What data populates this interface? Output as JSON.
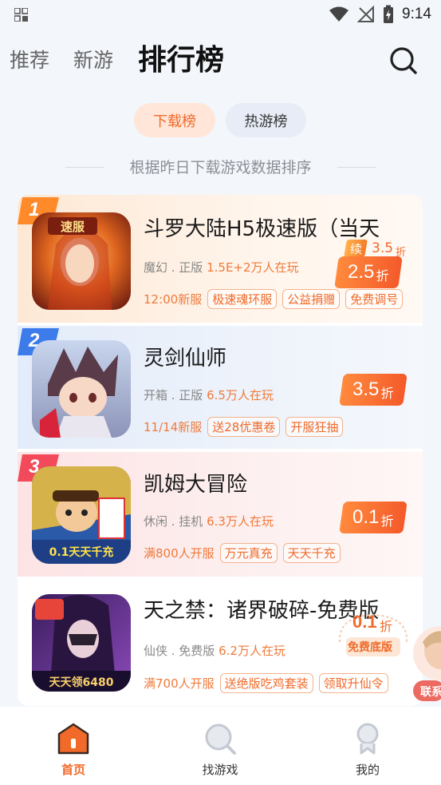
{
  "status_bar": {
    "time": "9:14"
  },
  "nav_tabs": [
    {
      "label": "推荐"
    },
    {
      "label": "新游"
    },
    {
      "label": "排行榜"
    }
  ],
  "sub_tabs": [
    {
      "label": "下载榜"
    },
    {
      "label": "热游榜"
    }
  ],
  "caption": "根据昨日下载游戏数据排序",
  "games": [
    {
      "rank": "1",
      "title": "斗罗大陆H5极速版（当天",
      "category": "魔幻 . 正版",
      "players": "1.5E+2万人在玩",
      "open_label": "12:00新服",
      "tags": [
        "极速魂环服",
        "公益捐赠",
        "免费调号"
      ],
      "renew_label": "续",
      "renew_value": "3.5",
      "renew_unit": "折",
      "discount": "2.5",
      "discount_unit": "折",
      "icon_label": "速服"
    },
    {
      "rank": "2",
      "title": "灵剑仙师",
      "category": "开箱 . 正版",
      "players": "6.5万人在玩",
      "open_label": "11/14新服",
      "tags": [
        "送28优惠卷",
        "开服狂抽"
      ],
      "discount": "3.5",
      "discount_unit": "折"
    },
    {
      "rank": "3",
      "title": "凯姆大冒险",
      "category": "休闲 . 挂机",
      "players": "6.3万人在玩",
      "open_label": "满800人开服",
      "tags": [
        "万元真充",
        "天天千充"
      ],
      "discount": "0.1",
      "discount_unit": "折",
      "icon_label": "0.1天天千充"
    },
    {
      "rank": "",
      "title": "天之禁：诸界破碎-免费版",
      "category": "仙侠 . 免费版",
      "players": "6.2万人在玩",
      "open_label": "满700人开服",
      "tags": [
        "送绝版吃鸡套装",
        "领取升仙令"
      ],
      "discount": "0.1",
      "discount_unit": "折",
      "discount_sub": "免费底版",
      "icon_label": "天天领6480"
    }
  ],
  "floating_label": "联系",
  "bottom_nav": [
    {
      "label": "首页"
    },
    {
      "label": "找游戏"
    },
    {
      "label": "我的"
    }
  ],
  "colors": {
    "accent": "#f26a2a",
    "background": "#f3f6fb"
  }
}
